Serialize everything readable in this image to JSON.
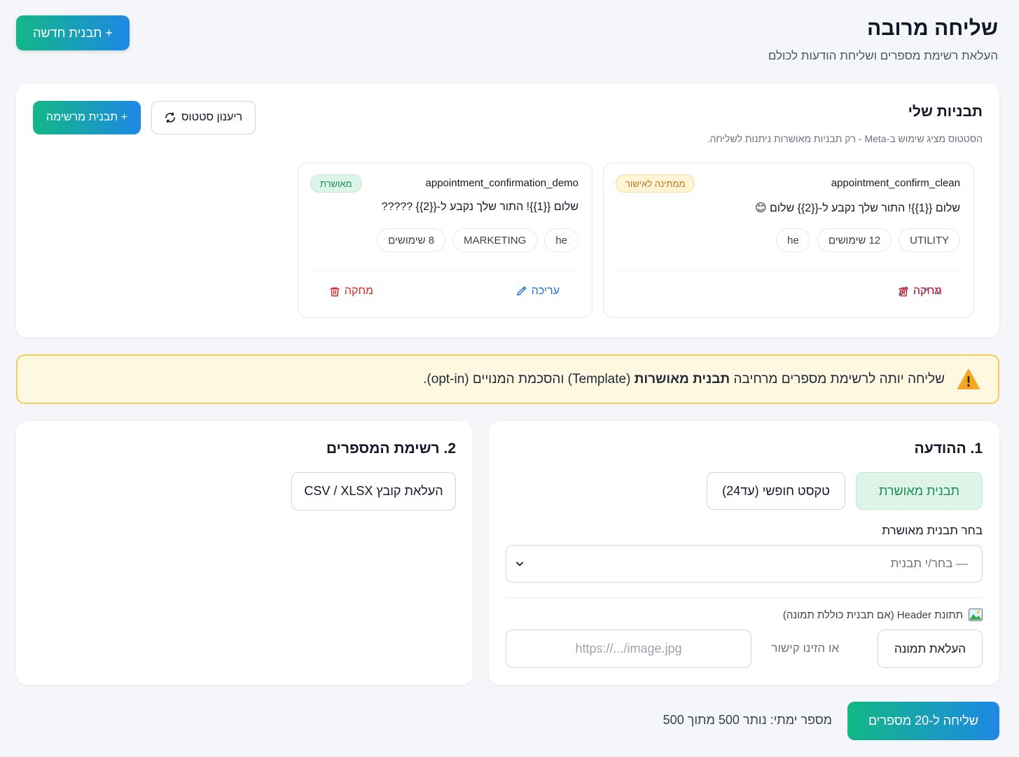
{
  "header": {
    "title": "שליחה מרובה",
    "subtitle": "העלאת רשימת מספרים ושליחת הודעות לכולם",
    "new_template_label": "+ תבנית חדשה"
  },
  "templates": {
    "title": "תבניות שלי",
    "note": "הסטטוס מציג שימוש ב-Meta - רק תבניות מאושרות ניתנות לשליחה.",
    "refresh_label": "ריענון סטטוס",
    "list_template_label": "+ תבנית מרשימה",
    "items": [
      {
        "name": "appointment_confirm_clean",
        "status": "ממתינה לאישור",
        "body": "שלום {{1}}! התור שלך נקבע ל-{{2}} שלום 😊",
        "chips": [
          "UTILITY",
          "12 שימושים",
          "he"
        ],
        "edit_label": "עריכה",
        "delete_label": "מחקה"
      },
      {
        "name": "appointment_confirmation_demo",
        "status": "מאושרת",
        "body": "שלום {{1}}! התור שלך נקבע ל-{{2}} ?????",
        "chips": [
          "he",
          "MARKETING",
          "8 שימושים"
        ],
        "edit_label": "עריכה",
        "delete_label": "מחקה"
      }
    ]
  },
  "warning": {
    "prefix": "שליחה יותה לרשימת מספרים מרחיבה ",
    "bold": "תבנית מאושרות",
    "suffix": " (Template) והסכמת המנויים (opt-in)."
  },
  "message": {
    "title": "1. ההודעה",
    "option_approved": "תבנית מאושרת",
    "option_free": "טקסט חופשי (עד24)",
    "select_label": "בחר תבנית מאושרת",
    "select_value": "— בחר/י תבנית",
    "header_label": "תתונת Header (אם תבנית כוללת תמונה)",
    "upload_image_label": "העלאת תמונה",
    "or_link_label": "או הזינו קישור",
    "url_placeholder": "https://.../image.jpg"
  },
  "numbers": {
    "title": "2. רשימת המספרים",
    "upload_file_label": "העלאת קובץ CSV / XLSX"
  },
  "footer": {
    "send_label": "שליחה ל-20 מספרים",
    "quota_text": "מספר ימתי: נותר 500 מתוך 500"
  },
  "colors": {
    "accent_start": "#12b886",
    "accent_end": "#1e88e5",
    "approved": "#1e8a52",
    "pending": "#b7791f",
    "danger": "#dc2626",
    "link": "#1d6fd8",
    "warning_bg": "#fff8e1"
  }
}
